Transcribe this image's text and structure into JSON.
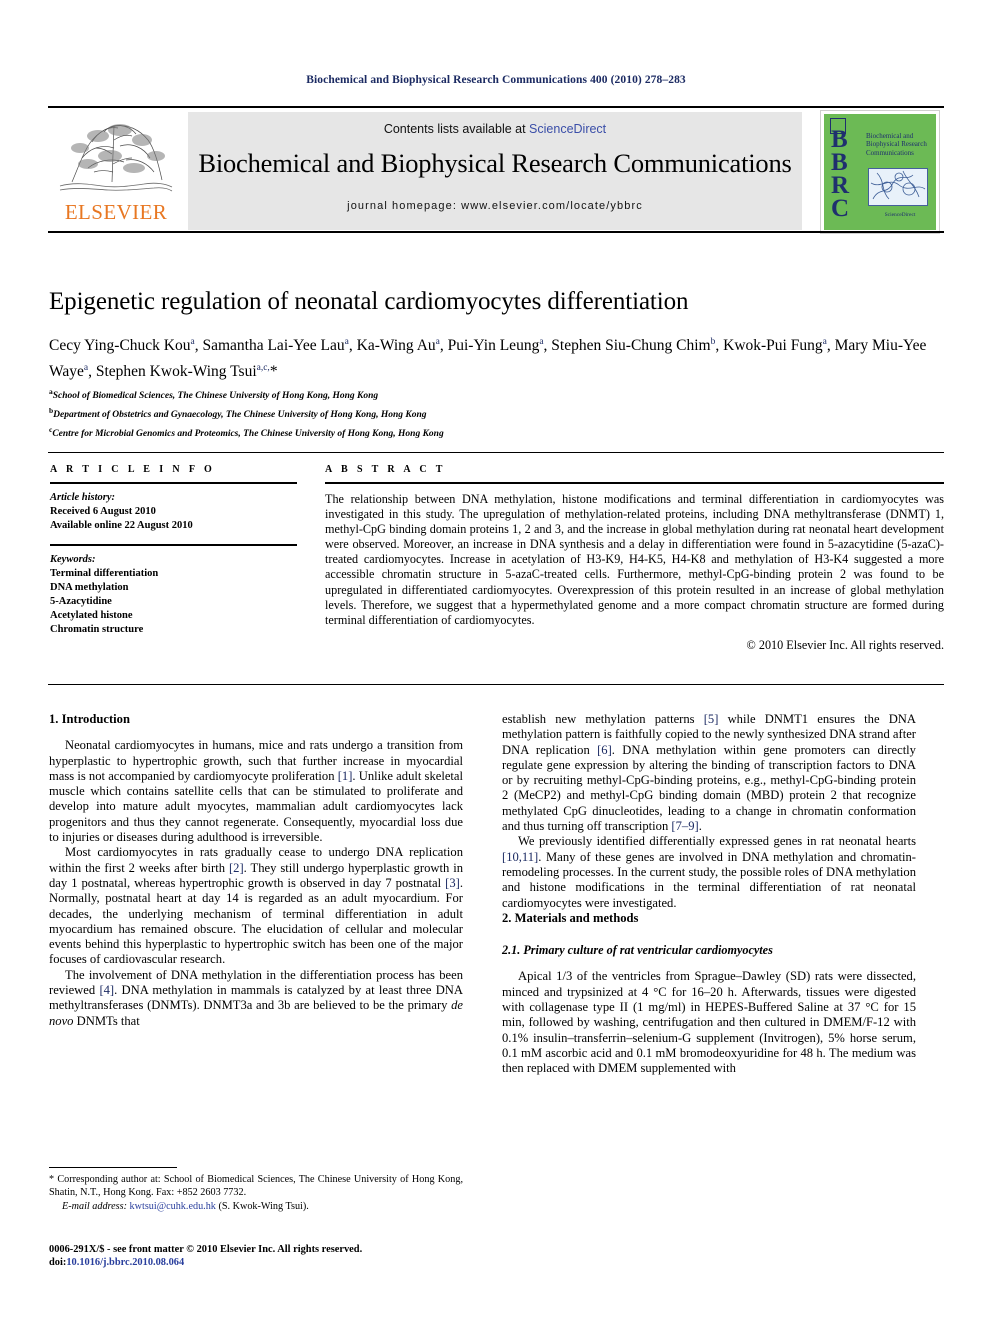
{
  "running_head": "Biochemical and Biophysical Research Communications 400 (2010) 278–283",
  "masthead": {
    "contents_prefix": "Contents lists available at ",
    "sciencedirect": "ScienceDirect",
    "journal_title": "Biochemical and Biophysical Research Communications",
    "homepage": "journal homepage: www.elsevier.com/locate/ybbrc",
    "publisher_name": "ELSEVIER",
    "cover": {
      "acronym_lines": [
        "B",
        "B",
        "R",
        "C"
      ],
      "title": "Biochemical and Biophysical Research Communications",
      "sciencedirect_caption": "ScienceDirect"
    },
    "colors": {
      "cover_green": "#6cba55",
      "cover_navy": "#1f2f6e",
      "elsevier_orange": "#e87722",
      "banner_gray": "#e6e6e6",
      "link_blue": "#3a4ea8"
    }
  },
  "article": {
    "title": "Epigenetic regulation of neonatal cardiomyocytes differentiation",
    "authors_html": "Cecy Ying-Chuck Kou<sup>a</sup>, Samantha Lai-Yee Lau<sup>a</sup>, Ka-Wing Au<sup>a</sup>, Pui-Yin Leung<sup>a</sup>, Stephen Siu-Chung Chim<sup>b</sup>, Kwok-Pui Fung<sup>a</sup>, Mary Miu-Yee Waye<sup>a</sup>, Stephen Kwok-Wing Tsui<sup>a,c,</sup>*",
    "affiliations": [
      {
        "marker": "a",
        "text": "School of Biomedical Sciences, The Chinese University of Hong Kong, Hong Kong"
      },
      {
        "marker": "b",
        "text": "Department of Obstetrics and Gynaecology, The Chinese University of Hong Kong, Hong Kong"
      },
      {
        "marker": "c",
        "text": "Centre for Microbial Genomics and Proteomics, The Chinese University of Hong Kong, Hong Kong"
      }
    ]
  },
  "article_info": {
    "heading": "A R T I C L E    I N F O",
    "history_label": "Article history:",
    "history_lines": [
      "Received 6 August 2010",
      "Available online 22 August 2010"
    ],
    "keywords_label": "Keywords:",
    "keywords": [
      "Terminal differentiation",
      "DNA methylation",
      "5-Azacytidine",
      "Acetylated histone",
      "Chromatin structure"
    ]
  },
  "abstract": {
    "heading": "A B S T R A C T",
    "text": "The relationship between DNA methylation, histone modifications and terminal differentiation in cardiomyocytes was investigated in this study. The upregulation of methylation-related proteins, including DNA methyltransferase (DNMT) 1, methyl-CpG binding domain proteins 1, 2 and 3, and the increase in global methylation during rat neonatal heart development were observed. Moreover, an increase in DNA synthesis and a delay in differentiation were found in 5-azacytidine (5-azaC)-treated cardiomyocytes. Increase in acetylation of H3-K9, H4-K5, H4-K8 and methylation of H3-K4 suggested a more accessible chromatin structure in 5-azaC-treated cells. Furthermore, methyl-CpG-binding protein 2 was found to be upregulated in differentiated cardiomyocytes. Overexpression of this protein resulted in an increase of global methylation levels. Therefore, we suggest that a hypermethylated genome and a more compact chromatin structure are formed during terminal differentiation of cardiomyocytes.",
    "copyright": "© 2010 Elsevier Inc. All rights reserved."
  },
  "body": {
    "left": {
      "intro_heading": "1. Introduction",
      "paragraphs": [
        "Neonatal cardiomyocytes in humans, mice and rats undergo a transition from hyperplastic to hypertrophic growth, such that further increase in myocardial mass is not accompanied by cardiomyocyte proliferation [1]. Unlike adult skeletal muscle which contains satellite cells that can be stimulated to proliferate and develop into mature adult myocytes, mammalian adult cardiomyocytes lack progenitors and thus they cannot regenerate. Consequently, myocardial loss due to injuries or diseases during adulthood is irreversible.",
        "Most cardiomyocytes in rats gradually cease to undergo DNA replication within the first 2 weeks after birth [2]. They still undergo hyperplastic growth in day 1 postnatal, whereas hypertrophic growth is observed in day 7 postnatal [3]. Normally, postnatal heart at day 14 is regarded as an adult myocardium. For decades, the underlying mechanism of terminal differentiation in adult myocardium has remained obscure. The elucidation of cellular and molecular events behind this hyperplastic to hypertrophic switch has been one of the major focuses of cardiovascular research.",
        "The involvement of DNA methylation in the differentiation process has been reviewed [4]. DNA methylation in mammals is catalyzed by at least three DNA methyltransferases (DNMTs). DNMT3a and 3b are believed to be the primary de novo DNMTs that"
      ]
    },
    "right": {
      "continuation": "establish new methylation patterns [5] while DNMT1 ensures the DNA methylation pattern is faithfully copied to the newly synthesized DNA strand after DNA replication [6]. DNA methylation within gene promoters can directly regulate gene expression by altering the binding of transcription factors to DNA or by recruiting methyl-CpG-binding proteins, e.g., methyl-CpG-binding protein 2 (MeCP2) and methyl-CpG binding domain (MBD) protein 2 that recognize methylated CpG dinucleotides, leading to a change in chromatin conformation and thus turning off transcription [7–9].",
      "paragraph2": "We previously identified differentially expressed genes in rat neonatal hearts [10,11]. Many of these genes are involved in DNA methylation and chromatin-remodeling processes. In the current study, the possible roles of DNA methylation and histone modifications in the terminal differentiation of rat neonatal cardiomyocytes were investigated.",
      "methods_heading": "2. Materials and methods",
      "subsection_heading": "2.1. Primary culture of rat ventricular cardiomyocytes",
      "methods_paragraph": "Apical 1/3 of the ventricles from Sprague–Dawley (SD) rats were dissected, minced and trypsinized at 4 °C for 16–20 h. Afterwards, tissues were digested with collagenase type II (1 mg/ml) in HEPES-Buffered Saline at 37 °C for 15 min, followed by washing, centrifugation and then cultured in DMEM/F-12 with 0.1% insulin–transferrin–selenium-G supplement (Invitrogen), 5% horse serum, 0.1 mM ascorbic acid and 0.1 mM bromodeoxyuridine for 48 h. The medium was then replaced with DMEM supplemented with"
    }
  },
  "footnote": {
    "corresponding": "* Corresponding author at: School of Biomedical Sciences, The Chinese University of Hong Kong, Shatin, N.T., Hong Kong. Fax: +852 2603 7732.",
    "email_label": "E-mail address:",
    "email": "kwtsui@cuhk.edu.hk",
    "email_owner": "(S. Kwok-Wing Tsui)."
  },
  "imprint": {
    "line1": "0006-291X/$ - see front matter © 2010 Elsevier Inc. All rights reserved.",
    "doi_label": "doi:",
    "doi_value": "10.1016/j.bbrc.2010.08.064"
  }
}
